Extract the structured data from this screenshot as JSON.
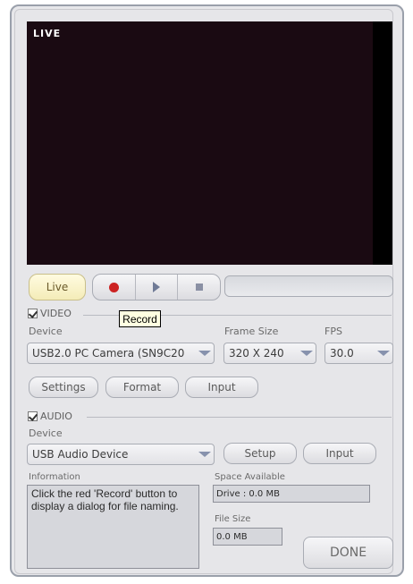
{
  "preview": {
    "live_indicator": "LIVE"
  },
  "controls": {
    "live_label": "Live",
    "record_tooltip": "Record"
  },
  "video": {
    "section_label": "VIDEO",
    "enabled": true,
    "device_label": "Device",
    "device_value": "USB2.0 PC Camera (SN9C20",
    "frame_size_label": "Frame Size",
    "frame_size_value": "320 X 240",
    "fps_label": "FPS",
    "fps_value": "30.0",
    "settings_label": "Settings",
    "format_label": "Format",
    "input_label": "Input"
  },
  "audio": {
    "section_label": "AUDIO",
    "enabled": true,
    "device_label": "Device",
    "device_value": "USB Audio Device",
    "setup_label": "Setup",
    "input_label": "Input"
  },
  "info": {
    "information_label": "Information",
    "information_text": "Click the red 'Record' button to display a dialog for file naming.",
    "space_available_label": "Space Available",
    "space_available_value": "Drive : 0.0 MB",
    "file_size_label": "File Size",
    "file_size_value": "0.0 MB"
  },
  "done_label": "DONE",
  "colors": {
    "record": "#cc2222",
    "live_button": "#fffbe0",
    "panel": "#e7e7ea"
  }
}
